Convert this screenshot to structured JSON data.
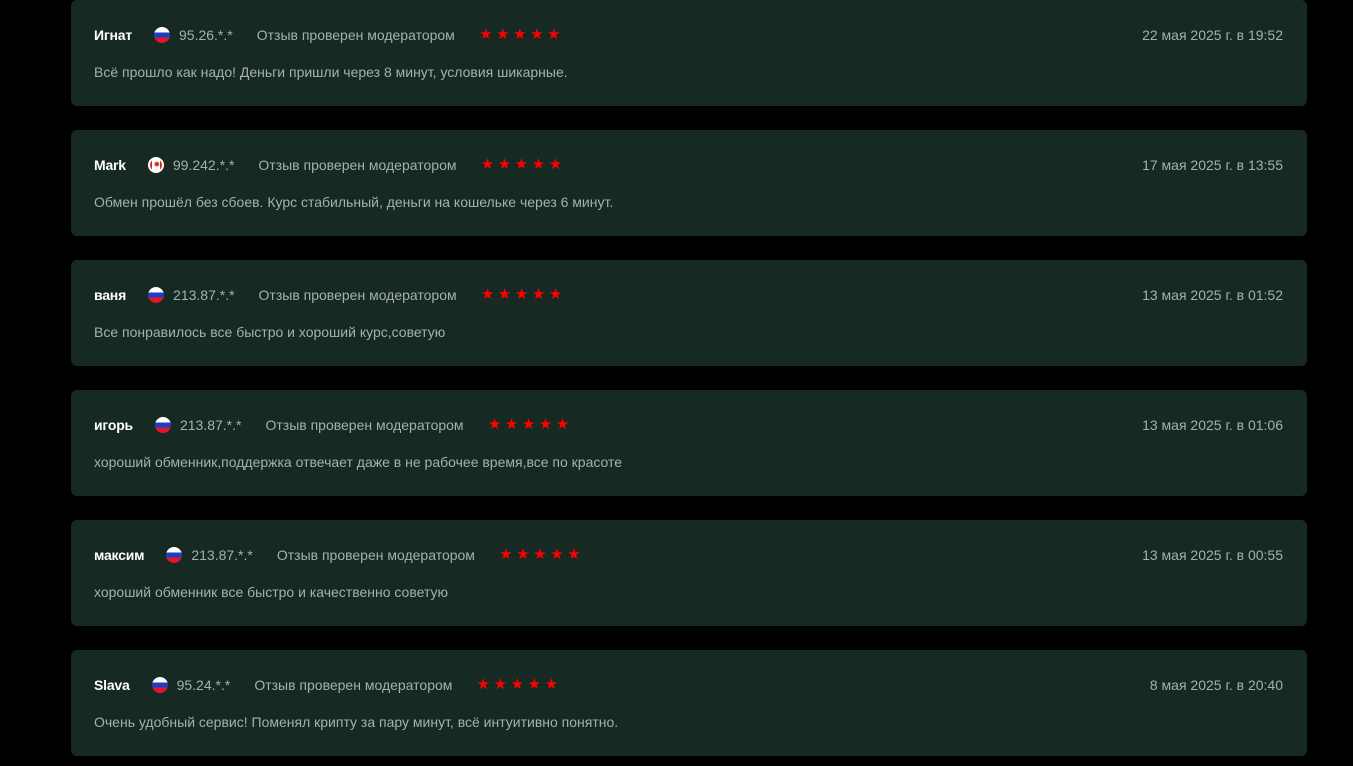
{
  "colors": {
    "page_background": "#000000",
    "card_background": "#172923",
    "star_color": "#ff0000",
    "name_color": "#ffffff",
    "muted_text": "#a7b0ad"
  },
  "reviews": [
    {
      "name": "Игнат",
      "flag": "russia-flag-icon",
      "ip": "95.26.*.*",
      "verified": "Отзыв проверен модератором",
      "rating": 5,
      "date": "22 мая 2025 г. в 19:52",
      "text": "Всё прошло как надо! Деньги пришли через 8 минут, условия шикарные."
    },
    {
      "name": "Mark",
      "flag": "canada-flag-icon",
      "ip": "99.242.*.*",
      "verified": "Отзыв проверен модератором",
      "rating": 5,
      "date": "17 мая 2025 г. в 13:55",
      "text": "Обмен прошёл без сбоев. Курс стабильный, деньги на кошельке через 6 минут."
    },
    {
      "name": "ваня",
      "flag": "russia-flag-icon",
      "ip": "213.87.*.*",
      "verified": "Отзыв проверен модератором",
      "rating": 5,
      "date": "13 мая 2025 г. в 01:52",
      "text": "Все понравилось все быстро и хороший курс,советую"
    },
    {
      "name": "игорь",
      "flag": "russia-flag-icon",
      "ip": "213.87.*.*",
      "verified": "Отзыв проверен модератором",
      "rating": 5,
      "date": "13 мая 2025 г. в 01:06",
      "text": "хороший обменник,поддержка отвечает даже в не рабочее время,все по красоте"
    },
    {
      "name": "максим",
      "flag": "russia-flag-icon",
      "ip": "213.87.*.*",
      "verified": "Отзыв проверен модератором",
      "rating": 5,
      "date": "13 мая 2025 г. в 00:55",
      "text": "хороший обменник все быстро и качественно советую"
    },
    {
      "name": "Slava",
      "flag": "russia-flag-icon",
      "ip": "95.24.*.*",
      "verified": "Отзыв проверен модератором",
      "rating": 5,
      "date": "8 мая 2025 г. в 20:40",
      "text": "Очень удобный сервис! Поменял крипту за пару минут, всё интуитивно понятно."
    }
  ]
}
